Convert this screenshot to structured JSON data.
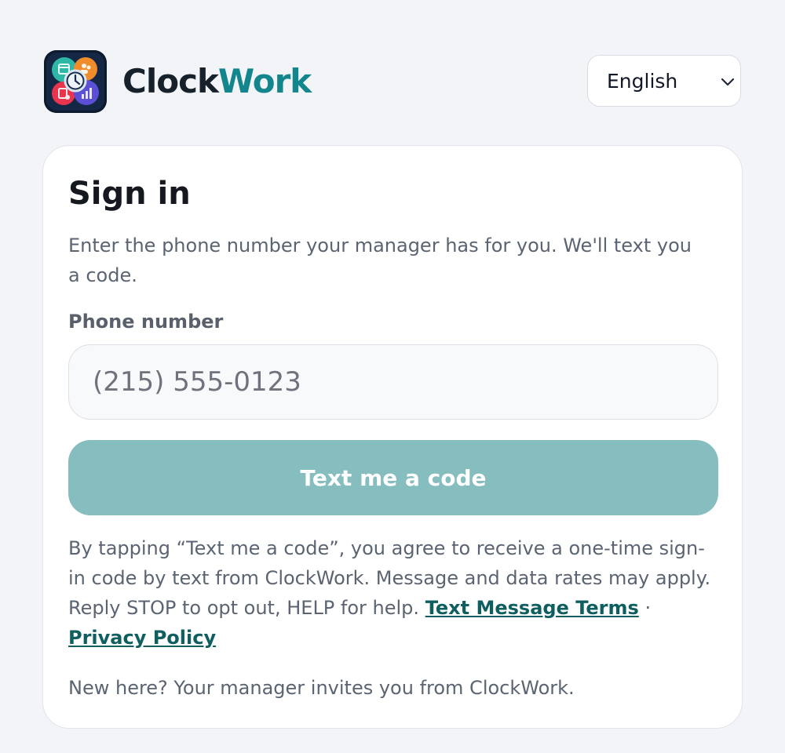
{
  "header": {
    "brand_part1": "Clock",
    "brand_part2": "Work",
    "language": {
      "selected": "English",
      "icon": "chevron-down-icon"
    }
  },
  "signin": {
    "title": "Sign in",
    "intro": "Enter the phone number your manager has for you. We'll text you a code.",
    "phone_label": "Phone number",
    "phone_placeholder": "(215) 555-0123",
    "submit_label": "Text me a code",
    "consent_text": "By tapping “Text me a code”, you agree to receive a one-time sign-in code by text from ClockWork. Message and data rates may apply. Reply STOP to opt out, HELP for help.",
    "terms_link": "Text Message Terms",
    "separator": "·",
    "privacy_link": "Privacy Policy",
    "footer_note": "New here? Your manager invites you from ClockWork."
  },
  "colors": {
    "background": "#f3f4f7",
    "brand_dark": "#17212b",
    "brand_accent": "#13868d",
    "button_disabled": "#86bdbf",
    "link": "#0f5f61"
  }
}
